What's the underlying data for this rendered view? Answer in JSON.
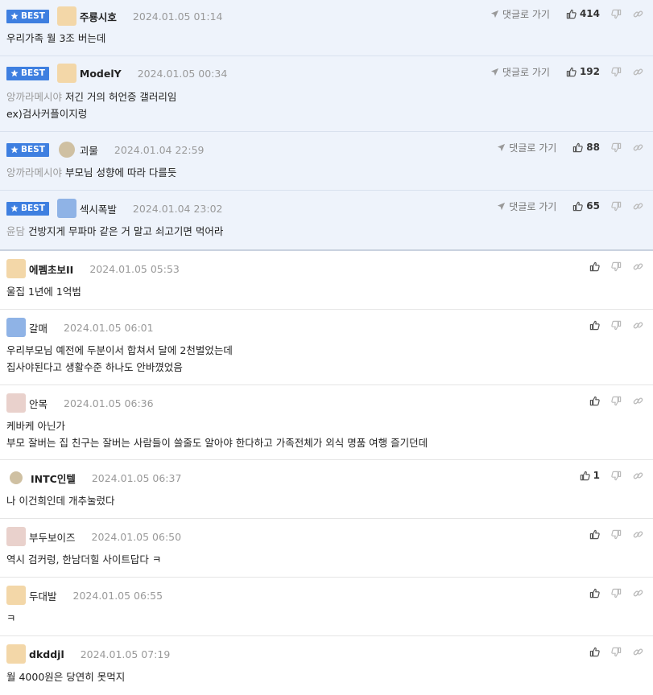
{
  "colors": {
    "accent": "#3e7fe0",
    "best_bg": "#eef3fb",
    "muted": "#999999"
  },
  "labels": {
    "best": "BEST",
    "goto": "댓글로 가기"
  },
  "icons": {
    "star": "star-icon",
    "goto": "paper-plane-icon",
    "up": "thumbs-up-icon",
    "down": "thumbs-down-icon",
    "link": "link-icon"
  },
  "best_comments": [
    {
      "nick": "주룡시호",
      "time": "2024.01.05 01:14",
      "up": "414",
      "lines": [
        {
          "ref": "",
          "text": "우리가족 월 3조 버는데"
        }
      ]
    },
    {
      "nick": "ModelY",
      "time": "2024.01.05 00:34",
      "up": "192",
      "lines": [
        {
          "ref": "앙까라메시야",
          "text": "저긴 거의 허언증 갤러리임"
        },
        {
          "ref": "",
          "text": "ex)검사커플이지렁"
        }
      ]
    },
    {
      "nick": "괴물",
      "time": "2024.01.04 22:59",
      "up": "88",
      "lines": [
        {
          "ref": "앙까라메시야",
          "text": "부모님 성향에 따라 다를듯"
        }
      ]
    },
    {
      "nick": "섹시폭발",
      "time": "2024.01.04 23:02",
      "up": "65",
      "lines": [
        {
          "ref": "윤담",
          "text": "건방지게 무파마 같은 거 말고 쇠고기면 먹어라"
        }
      ]
    }
  ],
  "comments": [
    {
      "nick": "에펨초보II",
      "time": "2024.01.05 05:53",
      "up": "",
      "lines": [
        "울집 1년에 1억범"
      ]
    },
    {
      "nick": "갈매",
      "time": "2024.01.05 06:01",
      "up": "",
      "lines": [
        "우리부모님 예전에 두분이서 합쳐서 달에 2천벌었는데",
        "집사야된다고 생활수준 하나도 안바꼈었음"
      ]
    },
    {
      "nick": "안목",
      "time": "2024.01.05 06:36",
      "up": "",
      "lines": [
        "케바케 아닌가",
        "부모 잘버는 집 친구는 잘버는 사람들이 쓸줄도 알아야 한다하고 가족전체가 외식 명품 여행 즐기던데"
      ]
    },
    {
      "nick": "INTC인텔",
      "time": "2024.01.05 06:37",
      "up": "1",
      "lines": [
        "나 이건희인데 개추눌렀다"
      ]
    },
    {
      "nick": "부두보이즈",
      "time": "2024.01.05 06:50",
      "up": "",
      "lines": [
        "역시 검커렁, 한남더힐 사이트답다 ㅋ"
      ]
    },
    {
      "nick": "두대발",
      "time": "2024.01.05 06:55",
      "up": "",
      "lines": [
        "ㅋ"
      ]
    },
    {
      "nick": "dkddjl",
      "time": "2024.01.05 07:19",
      "up": "",
      "lines": [
        "월 4000원은 당연히 못먹지"
      ]
    }
  ]
}
